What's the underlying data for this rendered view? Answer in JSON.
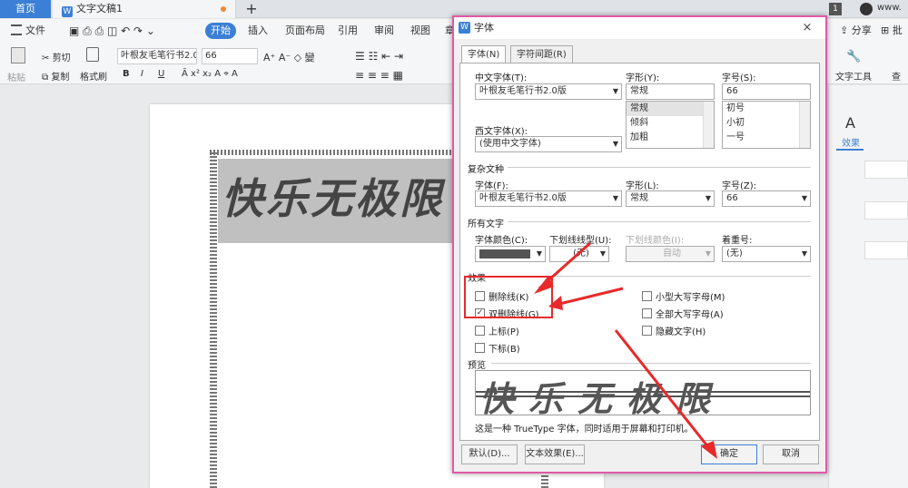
{
  "tabs": {
    "home": "首页",
    "doc": "文字文稿1",
    "plus": "+",
    "badge": "1",
    "user_short": "www."
  },
  "menu": {
    "file": "文件",
    "start": "开始",
    "insert": "插入",
    "layout": "页面布局",
    "reference": "引用",
    "review": "审阅",
    "view": "视图",
    "section": "章",
    "share": "分享",
    "batch": "批"
  },
  "toolbar": {
    "paste": "粘贴",
    "cut": "剪切",
    "copy": "复制",
    "format_painter": "格式刷",
    "font_name": "叶根友毛笔行书2.0",
    "font_size": "66",
    "bold": "B",
    "italic": "I",
    "underline": "U",
    "strike": "S",
    "text_tools": "文字工具",
    "find": "查找"
  },
  "document": {
    "content": "快乐无极限"
  },
  "right_pane": {
    "effects_label": "效果",
    "effects_icon": "A"
  },
  "dialog": {
    "title": "字体",
    "close": "×",
    "tab_font": "字体(N)",
    "tab_spacing": "字符间距(R)",
    "cn_font_label": "中文字体(T):",
    "cn_font_value": "叶根友毛笔行书2.0版",
    "style_label": "字形(Y):",
    "style_value": "常规",
    "style_options": [
      "常规",
      "倾斜",
      "加粗"
    ],
    "size_label": "字号(S):",
    "size_value": "66",
    "size_options": [
      "初号",
      "小初",
      "一号"
    ],
    "west_font_label": "西文字体(X):",
    "west_font_value": "(使用中文字体)",
    "complex_section": "复杂文种",
    "complex_font_label": "字体(F):",
    "complex_font_value": "叶根友毛笔行书2.0版",
    "complex_style_label": "字形(L):",
    "complex_style_value": "常规",
    "complex_size_label": "字号(Z):",
    "complex_size_value": "66",
    "all_text_section": "所有文字",
    "color_label": "字体颜色(C):",
    "underline_type_label": "下划线线型(U):",
    "underline_type_value": "(无)",
    "underline_color_label": "下划线颜色(I):",
    "underline_color_value": "自动",
    "emphasis_label": "着重号:",
    "emphasis_value": "(无)",
    "effects_section": "效果",
    "strikethrough": "删除线(K)",
    "double_strikethrough": "双删除线(G)",
    "superscript": "上标(P)",
    "subscript": "下标(B)",
    "small_caps": "小型大写字母(M)",
    "all_caps": "全部大写字母(A)",
    "hidden": "隐藏文字(H)",
    "preview_section": "预览",
    "preview_text": "快乐无极限",
    "truetype_note": "这是一种 TrueType 字体，同时适用于屏幕和打印机。",
    "default_btn": "默认(D)...",
    "text_effects_btn": "文本效果(E)...",
    "ok_btn": "确定",
    "cancel_btn": "取消",
    "font_color_hex": "#555555"
  }
}
